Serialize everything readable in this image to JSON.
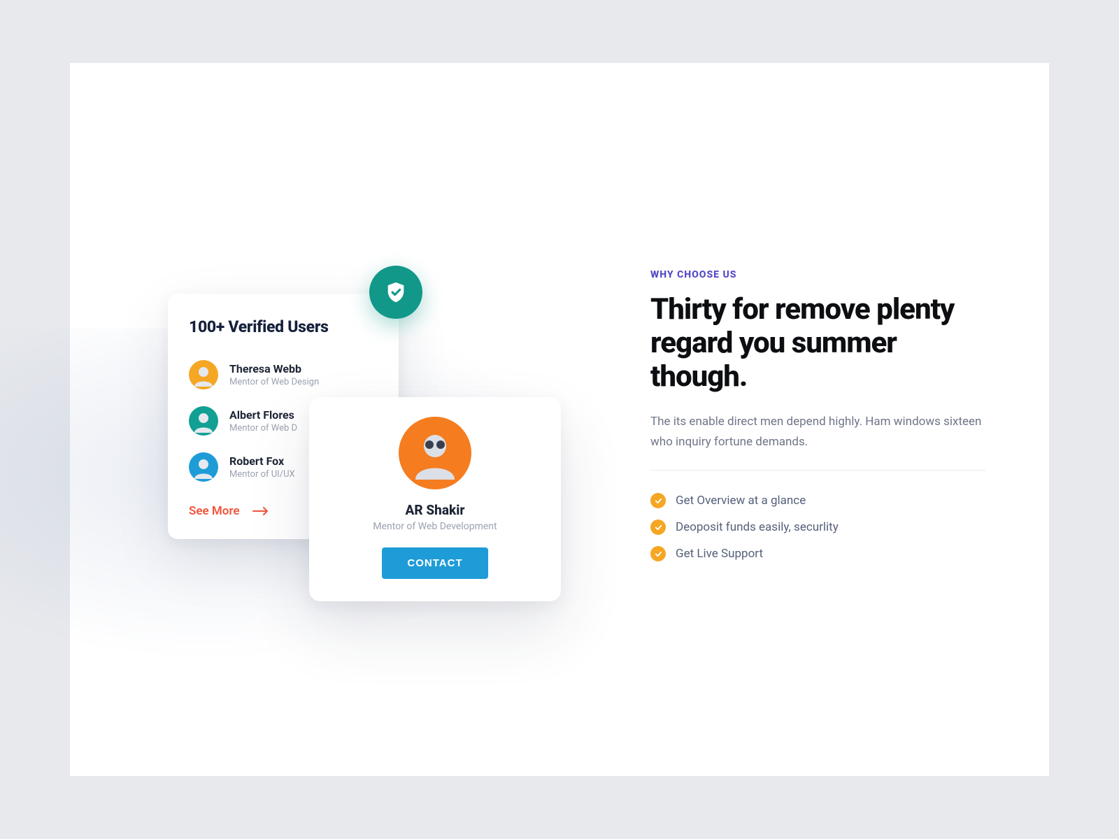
{
  "verified": {
    "title": "100+ Verified Users",
    "users": [
      {
        "name": "Theresa Webb",
        "role": "Mentor of Web Design",
        "avatar_bg": "#f5a623"
      },
      {
        "name": "Albert Flores",
        "role": "Mentor of Web D",
        "avatar_bg": "#11a093"
      },
      {
        "name": "Robert Fox",
        "role": "Mentor of UI/UX",
        "avatar_bg": "#1e9cd7"
      }
    ],
    "see_more": "See More"
  },
  "profile": {
    "name": "AR Shakir",
    "role": "Mentor of Web Development",
    "avatar_bg": "#f57c1f",
    "contact_label": "CONTACT"
  },
  "right": {
    "eyebrow": "WHY CHOOSE US",
    "headline": "Thirty for remove plenty regard you summer though.",
    "subtext": "The its enable direct men depend highly. Ham windows sixteen who inquiry fortune demands.",
    "features": [
      "Get Overview at a glance",
      "Deoposit funds easily, securlity",
      "Get Live Support"
    ]
  },
  "colors": {
    "teal": "#119889",
    "blue": "#1e9cd7",
    "orange": "#f6a623",
    "coral": "#f0543b",
    "indigo": "#5349c7"
  }
}
